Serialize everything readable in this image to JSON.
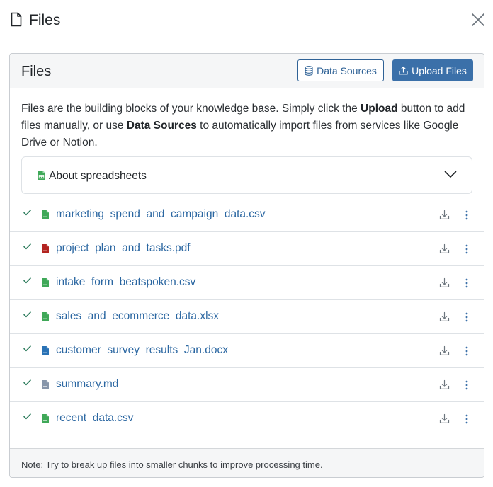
{
  "modal": {
    "title": "Files",
    "title_icon": "file-icon",
    "close_icon": "close-icon"
  },
  "card": {
    "title": "Files",
    "data_sources_label": "Data Sources",
    "upload_label": "Upload Files"
  },
  "intro": {
    "part1": "Files are the building blocks of your knowledge base. Simply click the ",
    "bold1": "Upload",
    "part2": " button to add files manually, or use ",
    "bold2": "Data Sources",
    "part3": " to automatically import files from services like Google Drive or Notion."
  },
  "accordion": {
    "label": "About spreadsheets",
    "icon": "spreadsheet-icon",
    "expanded": false
  },
  "files": [
    {
      "name": "marketing_spend_and_campaign_data.csv",
      "type": "csv"
    },
    {
      "name": "project_plan_and_tasks.pdf",
      "type": "pdf"
    },
    {
      "name": "intake_form_beatspoken.csv",
      "type": "csv"
    },
    {
      "name": "sales_and_ecommerce_data.xlsx",
      "type": "xlsx"
    },
    {
      "name": "customer_survey_results_Jan.docx",
      "type": "docx"
    },
    {
      "name": "summary.md",
      "type": "md"
    },
    {
      "name": "recent_data.csv",
      "type": "csv"
    }
  ],
  "footer": {
    "note": "Note: Try to break up files into smaller chunks to improve processing time."
  },
  "colors": {
    "link": "#2a66a1",
    "primary": "#3b70a9",
    "check": "#2a7a5a",
    "csv": "#3fa858",
    "pdf": "#b32420",
    "docx": "#2a72b5",
    "md": "#8796aa"
  }
}
